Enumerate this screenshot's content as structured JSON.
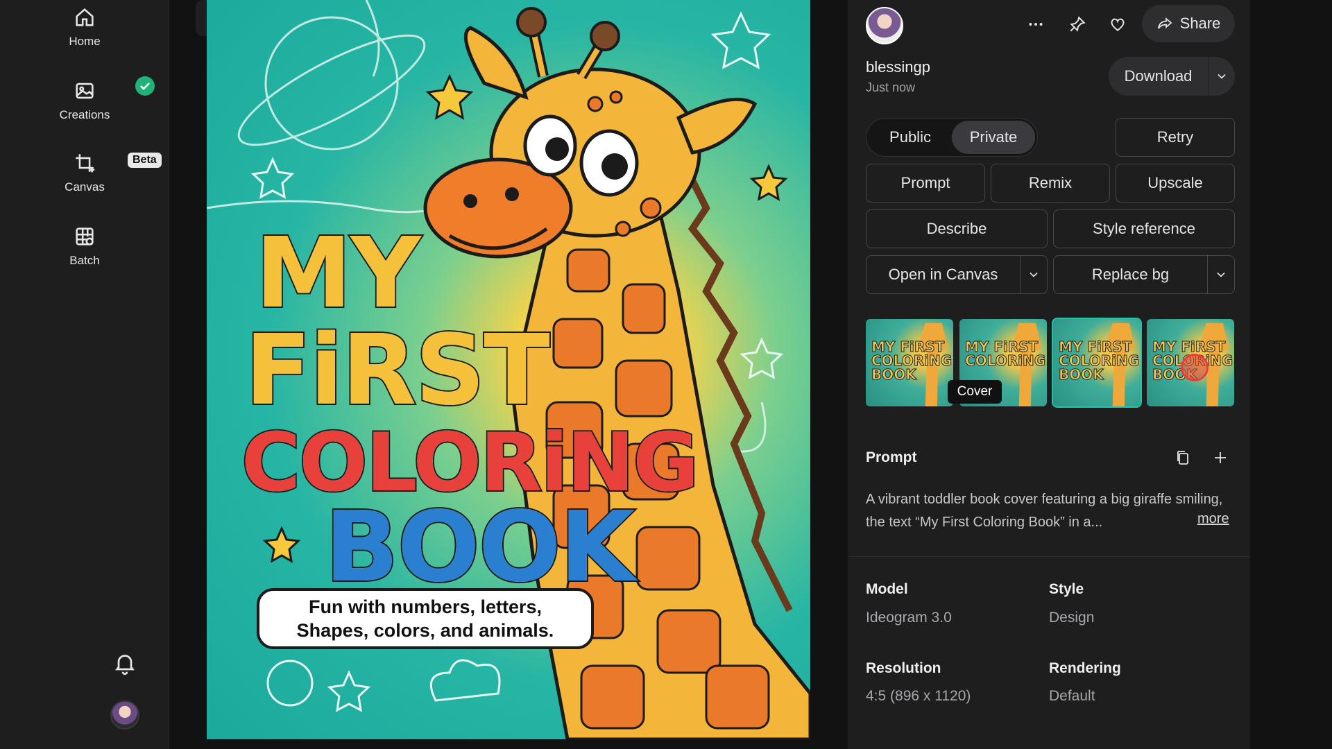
{
  "sidebar": {
    "items": [
      {
        "label": "Home",
        "icon": "home-icon"
      },
      {
        "label": "Creations",
        "icon": "image-icon"
      },
      {
        "label": "Canvas",
        "icon": "crop-icon",
        "badge": "Beta"
      },
      {
        "label": "Batch",
        "icon": "grid-icon"
      }
    ]
  },
  "poster": {
    "title_line1": "MY",
    "title_line2": "FiRST",
    "title_line3": "COLORiNG",
    "title_line4": "BOOK",
    "subtitle_line1": "Fun with numbers, letters,",
    "subtitle_line2": "Shapes, colors, and animals."
  },
  "panel": {
    "username": "blessingp",
    "time": "Just now",
    "share_label": "Share",
    "download_label": "Download",
    "visibility": {
      "public": "Public",
      "private": "Private",
      "selected": "Private"
    },
    "buttons": {
      "retry": "Retry",
      "prompt": "Prompt",
      "remix": "Remix",
      "upscale": "Upscale",
      "describe": "Describe",
      "style_reference": "Style reference",
      "open_in_canvas": "Open in Canvas",
      "replace_bg": "Replace bg"
    },
    "thumbs": [
      {
        "text": "MY FiRST COLORiNG BOOK"
      },
      {
        "text": "MY FiRST COLORiNG"
      },
      {
        "text": "MY FiRST COLORiNG BOOK"
      },
      {
        "text": "MY FiRST COLORiNG BOOK"
      }
    ],
    "tooltip": "Cover",
    "prompt_section": {
      "title": "Prompt",
      "text": "A vibrant toddler book cover featuring a big giraffe smiling, the text “My First Coloring Book” in a...",
      "more": "more"
    },
    "meta": {
      "model_label": "Model",
      "model_value": "Ideogram 3.0",
      "style_label": "Style",
      "style_value": "Design",
      "resolution_label": "Resolution",
      "resolution_value": "4:5 (896 x 1120)",
      "rendering_label": "Rendering",
      "rendering_value": "Default"
    }
  },
  "colors": {
    "accent_check": "#1fb37a",
    "panel_bg": "#1e1e1f",
    "title_yellow": "#f5c13a",
    "title_green": "#4cae45",
    "title_red": "#e8403a",
    "title_purple": "#8a55b8",
    "title_blue": "#2a7fd0",
    "title_orange": "#ef7d27"
  }
}
